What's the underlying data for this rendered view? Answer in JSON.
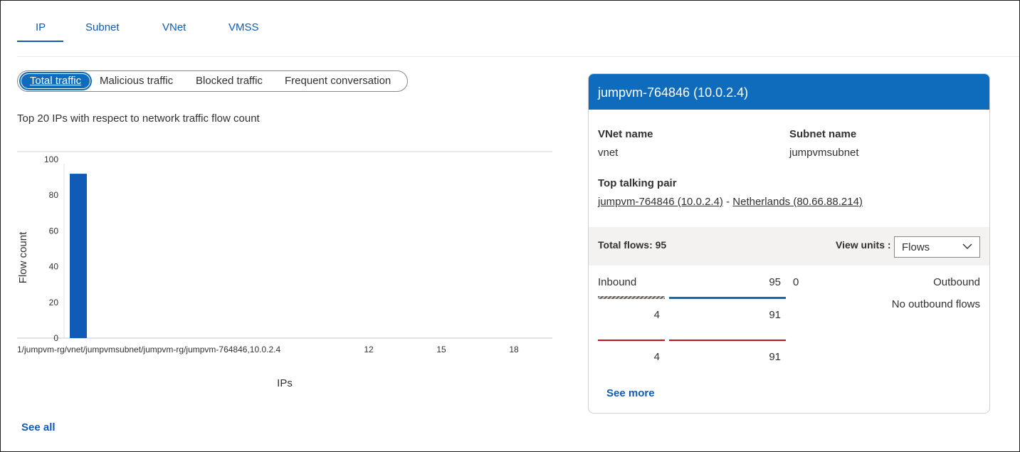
{
  "tabs": [
    {
      "label": "IP"
    },
    {
      "label": "Subnet"
    },
    {
      "label": "VNet"
    },
    {
      "label": "VMSS"
    }
  ],
  "filters": {
    "active": "Total traffic",
    "items": [
      "Total traffic",
      "Malicious traffic",
      "Blocked traffic",
      "Frequent conversation"
    ]
  },
  "chart_title": "Top 20 IPs with respect to network traffic flow count",
  "chart_data": {
    "type": "bar",
    "categories": [
      "1/jumpvm-rg/vnet/jumpvmsubnet/jumpvm-rg/jumpvm-764846,10.0.2.4"
    ],
    "values": [
      92
    ],
    "xtick_labels": [
      "1/jumpvm-rg/vnet/jumpvmsubnet/jumpvm-rg/jumpvm-764846,10.0.2.4",
      "12",
      "15",
      "18"
    ],
    "yticks": [
      0,
      20,
      40,
      60,
      80,
      100
    ],
    "ylim": [
      0,
      100
    ],
    "xlabel": "IPs",
    "ylabel": "Flow count",
    "bar_color": "#0f5bb5"
  },
  "see_all": "See all",
  "card": {
    "title": "jumpvm-764846 (10.0.2.4)",
    "vnet_label": "VNet name",
    "vnet_value": "vnet",
    "subnet_label": "Subnet name",
    "subnet_value": "jumpvmsubnet",
    "pair_label": "Top talking pair",
    "pair_left": "jumpvm-764846 (10.0.2.4)",
    "pair_sep": "-",
    "pair_right": "Netherlands (80.66.88.214)",
    "total_flows": "Total flows: 95",
    "view_units_label": "View units :",
    "view_units_value": "Flows",
    "inbound_label": "Inbound",
    "inbound_total": "95",
    "outbound_total": "0",
    "outbound_label": "Outbound",
    "no_outbound": "No outbound flows",
    "row1_left": "4",
    "row1_right": "91",
    "row2_left": "4",
    "row2_right": "91",
    "see_more": "See more",
    "colors": {
      "header": "#0f6cbd",
      "allowed": "#0f6cbd",
      "denied": "#c50f1f",
      "hatched": "#8a8886"
    }
  }
}
